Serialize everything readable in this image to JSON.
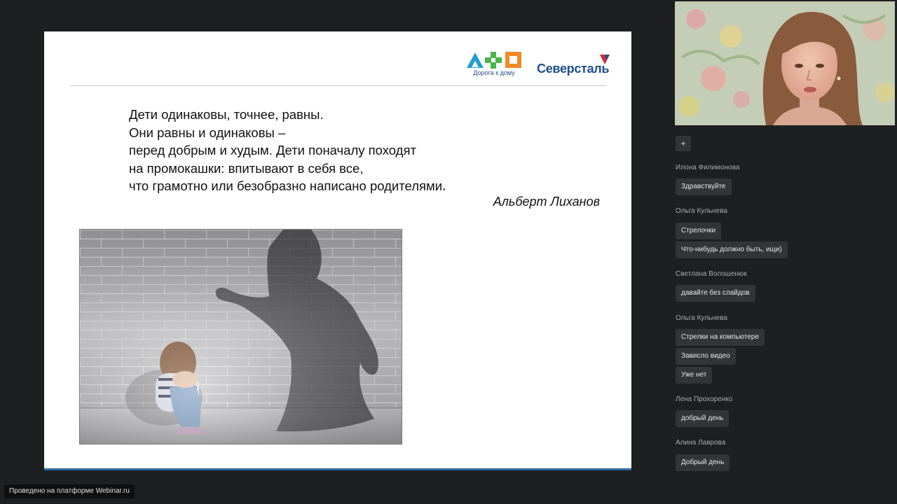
{
  "slide": {
    "logo_dkd_caption": "Дорога к дому",
    "logo_sev_text": "Северсталь",
    "quote_lines": [
      "Дети одинаковы, точнее, равны.",
      "Они равны и одинаковы –",
      "перед добрым и худым. Дети поначалу походят",
      "на промокашки: впитывают в себя все,",
      "что грамотно или безобразно написано родителями"
    ],
    "quote_end_mark": ".",
    "quote_author": "Альберт Лиханов"
  },
  "chat": {
    "add_label": "+",
    "groups": [
      {
        "author": "Илона Филимонова",
        "messages": [
          "Здравствуйте"
        ]
      },
      {
        "author": "Ольга Кульнева",
        "messages": [
          "Стрелочки",
          "Что-нибудь должно быть, ищи)"
        ]
      },
      {
        "author": "Светлана Волошенюк",
        "messages": [
          "давайте без слайдов"
        ]
      },
      {
        "author": "Ольга Кульнева",
        "messages": [
          "Стрелки на компьютере",
          "Зависло видео",
          "Уже нет"
        ]
      },
      {
        "author": "Лена Прохоренко",
        "messages": [
          "добрый день"
        ]
      },
      {
        "author": "Алина Лаврова",
        "messages": [
          "Добрый день"
        ]
      }
    ]
  },
  "footer": {
    "platform_text": "Проведено на платформе Webinar.ru"
  },
  "colors": {
    "background": "#1e1f20",
    "chat_bubble": "#333435",
    "slide_accent": "#2d6da3",
    "brand_blue": "#1d4f91"
  }
}
